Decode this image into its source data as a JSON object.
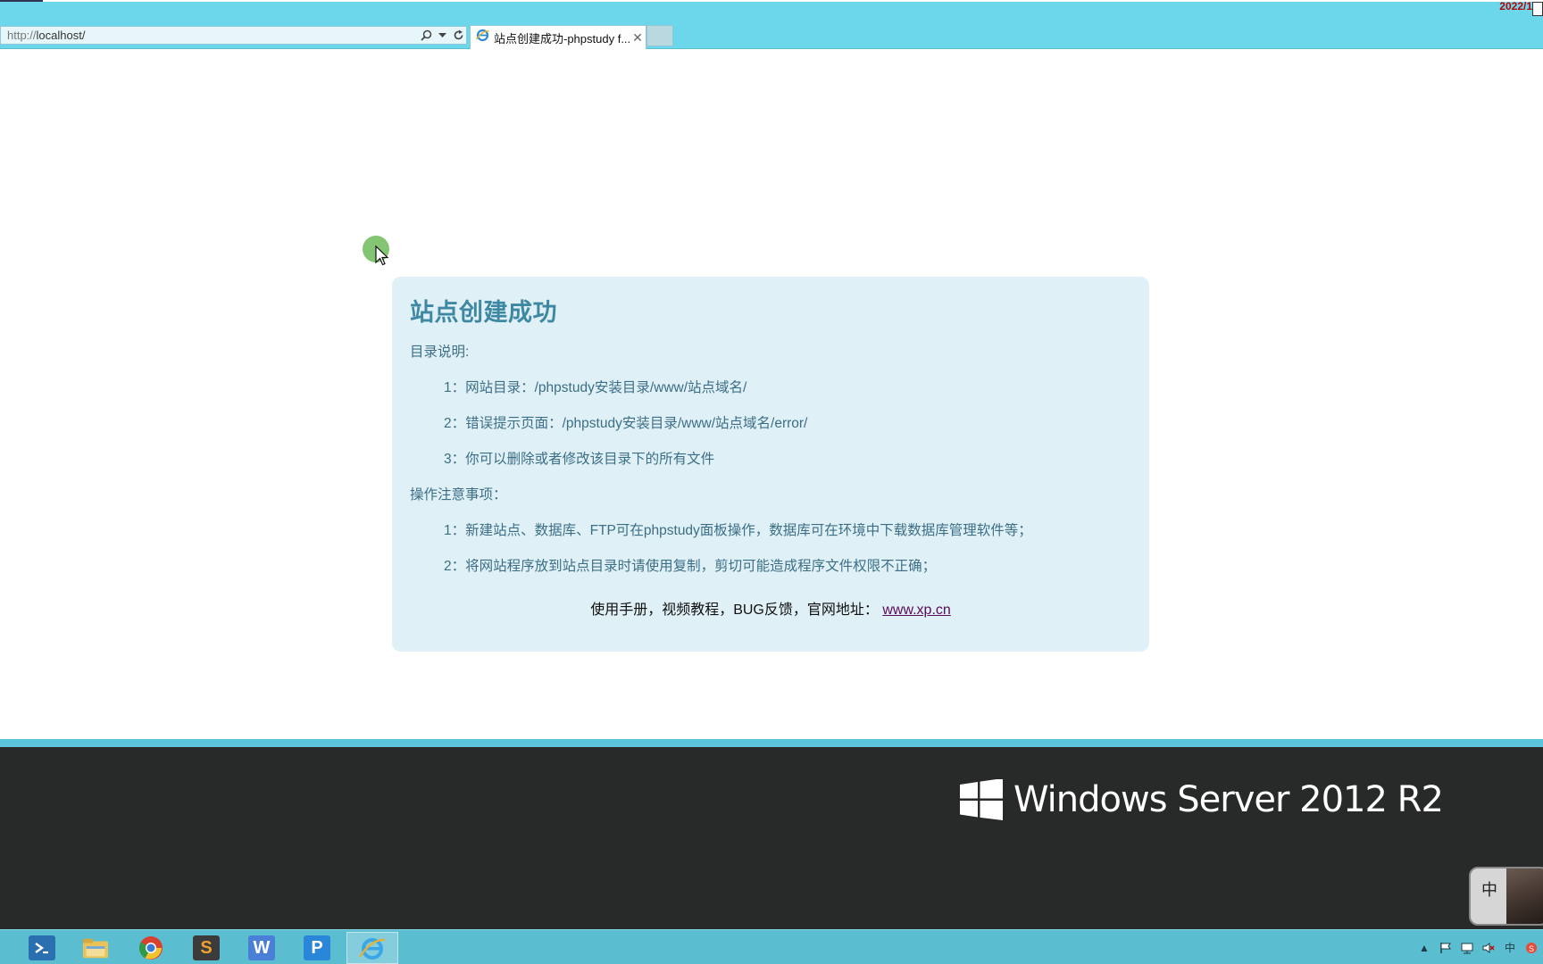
{
  "browser": {
    "address": {
      "protocol": "http://",
      "host": "localhost/"
    },
    "tab": {
      "title": "站点创建成功-phpstudy f...",
      "close_glyph": "✕"
    },
    "corner_date": "2022/1"
  },
  "page": {
    "title": "站点创建成功",
    "dir_section_title": "目录说明:",
    "dir_items": [
      "1：网站目录：/phpstudy安装目录/www/站点域名/",
      "2：错误提示页面：/phpstudy安装目录/www/站点域名/error/",
      "3：你可以删除或者修改该目录下的所有文件"
    ],
    "notes_section_title": "操作注意事项：",
    "notes_items": [
      "1：新建站点、数据库、FTP可在phpstudy面板操作，数据库可在环境中下载数据库管理软件等；",
      "2：将网站程序放到站点目录时请使用复制，剪切可能造成程序文件权限不正确；"
    ],
    "footer_text": "使用手册，视频教程，BUG反馈，官网地址：",
    "footer_link": "www.xp.cn"
  },
  "desktop": {
    "os_brand": "Windows Server 2012 R2",
    "ime_char": "中"
  },
  "taskbar": {
    "apps": [
      {
        "name": "powershell-icon",
        "glyph": "›_",
        "color": "#2a6fb0"
      },
      {
        "name": "file-explorer-icon",
        "glyph": "",
        "color": "#e8c35a"
      },
      {
        "name": "chrome-icon",
        "glyph": "",
        "color": "#d8412f"
      },
      {
        "name": "sublime-text-icon",
        "glyph": "S",
        "color": "#3b3b3b"
      },
      {
        "name": "wps-writer-icon",
        "glyph": "W",
        "color": "#4a7fd8"
      },
      {
        "name": "phpstudy-icon",
        "glyph": "P",
        "color": "#2a86d8"
      },
      {
        "name": "internet-explorer-icon",
        "glyph": "e",
        "color": "#3aa6e6"
      }
    ],
    "tray_lang": "中"
  },
  "colors": {
    "chrome": "#6cd6ea",
    "card_bg": "#dff0f6",
    "title": "#3f88a3",
    "body_text": "#3c6f86",
    "desktop_bg": "#272a29",
    "taskbar": "#5bbdd0"
  }
}
